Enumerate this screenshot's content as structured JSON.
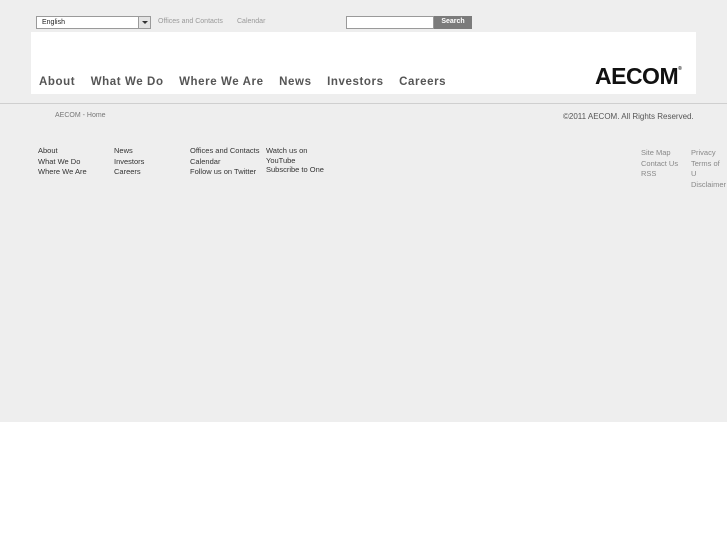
{
  "topbar": {
    "language": "English",
    "links": [
      "Offices and Contacts",
      "Calendar"
    ],
    "search_label": "Search"
  },
  "nav": {
    "items": [
      "About",
      "What We Do",
      "Where We Are",
      "News",
      "Investors",
      "Careers"
    ]
  },
  "logo_text": "AECOM",
  "breadcrumb": "AECOM - Home",
  "copyright": "©2011 AECOM. All Rights Reserved.",
  "footer": {
    "col1": [
      "About",
      "What We Do",
      "Where We Are"
    ],
    "col2": [
      "News",
      "Investors",
      "Careers"
    ],
    "col3": [
      "Offices and Contacts",
      "Calendar",
      "Follow us on Twitter"
    ],
    "col4": [
      "Watch us on",
      "YouTube",
      "Subscribe to One"
    ],
    "col5": [
      "Site Map",
      "Contact Us",
      "RSS"
    ],
    "col6": [
      "Privacy",
      "Terms of U",
      "Disclaimer"
    ]
  }
}
